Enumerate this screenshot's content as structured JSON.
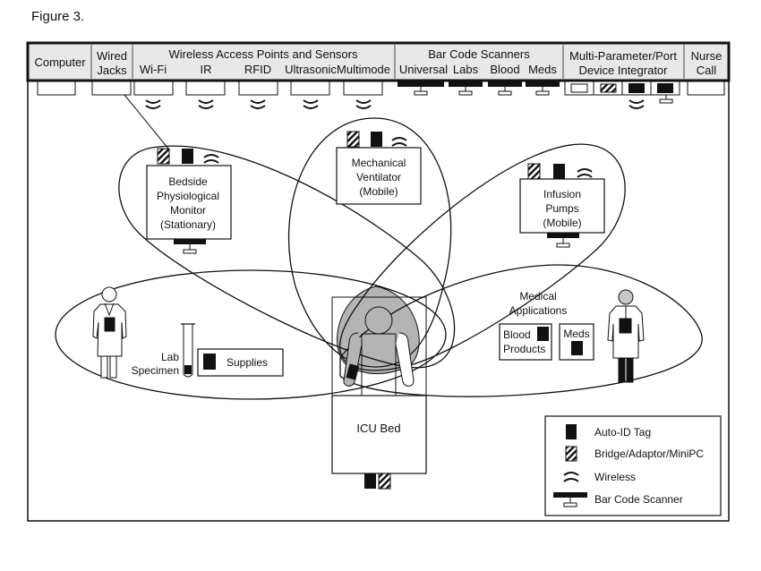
{
  "figure_title": "Figure 3.",
  "header": {
    "computer": "Computer",
    "wired_jacks": [
      "Wired",
      "Jacks"
    ],
    "wireless_group": "Wireless Access Points and Sensors",
    "wireless_items": [
      "Wi-Fi",
      "IR",
      "RFID",
      "Ultrasonic",
      "Multimode"
    ],
    "barcode_group": "Bar Code Scanners",
    "barcode_items": [
      "Universal",
      "Labs",
      "Blood",
      "Meds"
    ],
    "integrator": [
      "Multi-Parameter/Port",
      "Device Integrator"
    ],
    "nurse_call": [
      "Nurse",
      "Call"
    ]
  },
  "devices": {
    "monitor": [
      "Bedside",
      "Physiological",
      "Monitor",
      "(Stationary)"
    ],
    "ventilator": [
      "Mechanical",
      "Ventilator",
      "(Mobile)"
    ],
    "pumps": [
      "Infusion",
      "Pumps",
      "(Mobile)"
    ]
  },
  "left_zone": {
    "lab_specimen": [
      "Lab",
      "Specimen"
    ],
    "supplies": "Supplies"
  },
  "right_zone": {
    "medical_apps": [
      "Medical",
      "Applications"
    ],
    "blood_products": [
      "Blood",
      "Products"
    ],
    "meds": "Meds"
  },
  "bed": {
    "label": "ICU Bed"
  },
  "legend": {
    "items": [
      {
        "icon": "auto-id-tag-icon",
        "label": "Auto-ID Tag"
      },
      {
        "icon": "bridge-adaptor-icon",
        "label": "Bridge/Adaptor/MiniPC"
      },
      {
        "icon": "wireless-icon",
        "label": "Wireless"
      },
      {
        "icon": "barcode-scanner-icon",
        "label": "Bar Code Scanner"
      }
    ]
  },
  "colors": {
    "header_bg": "#e8e8e8",
    "highlight_gray": "#b4b4b4",
    "stroke": "#111111"
  }
}
